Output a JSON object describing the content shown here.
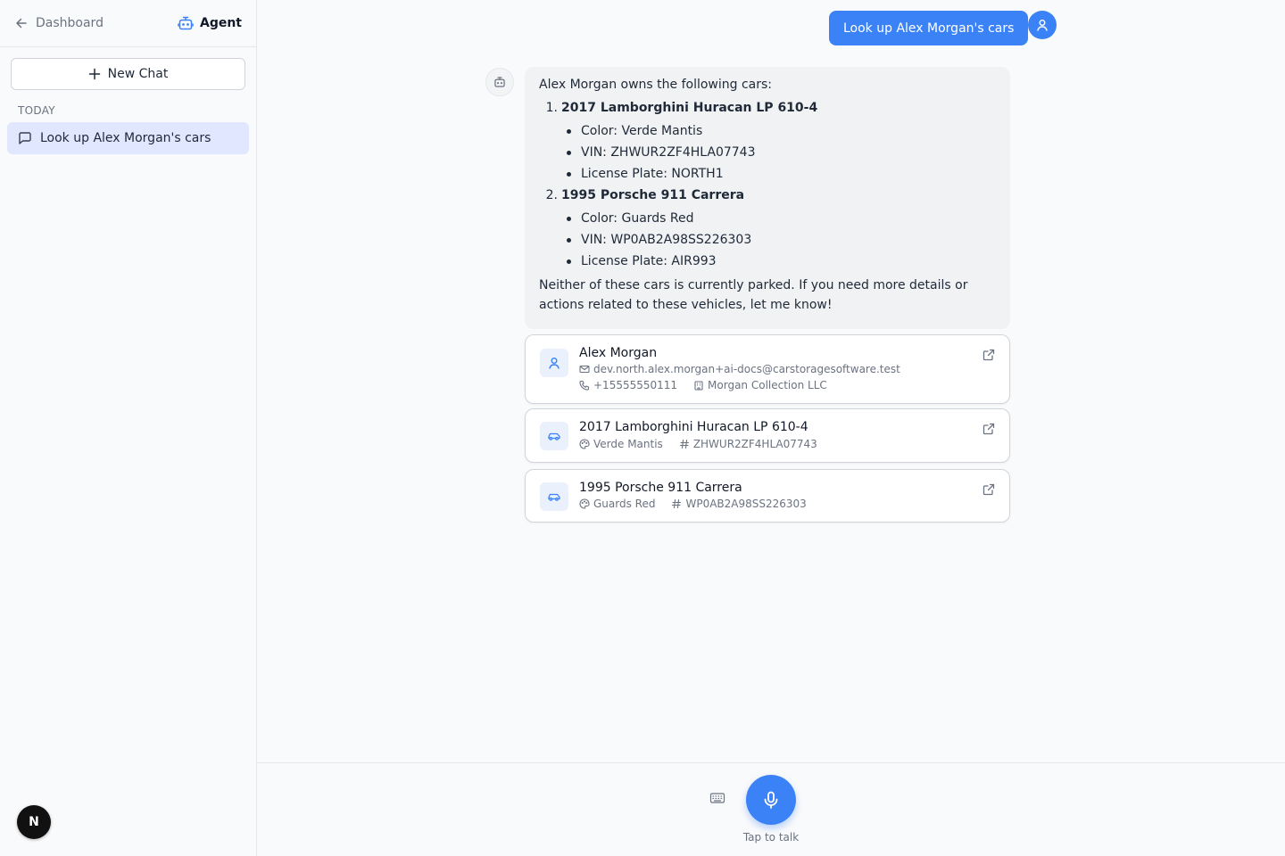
{
  "sidebar": {
    "back_label": "Dashboard",
    "agent_label": "Agent",
    "new_chat_label": "New Chat",
    "section_label": "TODAY",
    "chats": [
      {
        "label": "Look up Alex Morgan's cars"
      }
    ],
    "user_initial": "N"
  },
  "conversation": {
    "user_message": "Look up Alex Morgan's cars",
    "bot_intro": "Alex Morgan owns the following cars:",
    "cars": [
      {
        "num": "1.",
        "name": "2017 Lamborghini Huracan LP 610-4",
        "specs": [
          "Color: Verde Mantis",
          "VIN: ZHWUR2ZF4HLA07743",
          "License Plate: NORTH1"
        ]
      },
      {
        "num": "2.",
        "name": "1995 Porsche 911 Carrera",
        "specs": [
          "Color: Guards Red",
          "VIN: WP0AB2A98SS226303",
          "License Plate: AIR993"
        ]
      }
    ],
    "bot_outro": "Neither of these cars is currently parked. If you need more details or actions related to these vehicles, let me know!"
  },
  "cards": {
    "customer": {
      "name": "Alex Morgan",
      "email": "dev.north.alex.morgan+ai-docs@carstoragesoftware.test",
      "phone": "+15555550111",
      "company": "Morgan Collection LLC"
    },
    "vehicles": [
      {
        "title": "2017 Lamborghini Huracan LP 610-4",
        "color": "Verde Mantis",
        "vin": "ZHWUR2ZF4HLA07743"
      },
      {
        "title": "1995 Porsche 911 Carrera",
        "color": "Guards Red",
        "vin": "WP0AB2A98SS226303"
      }
    ]
  },
  "input": {
    "tap_label": "Tap to talk"
  },
  "colors": {
    "accent": "#3b82f6",
    "selected_chat": "#e0e7ff",
    "bubble": "#f1f2f4"
  }
}
